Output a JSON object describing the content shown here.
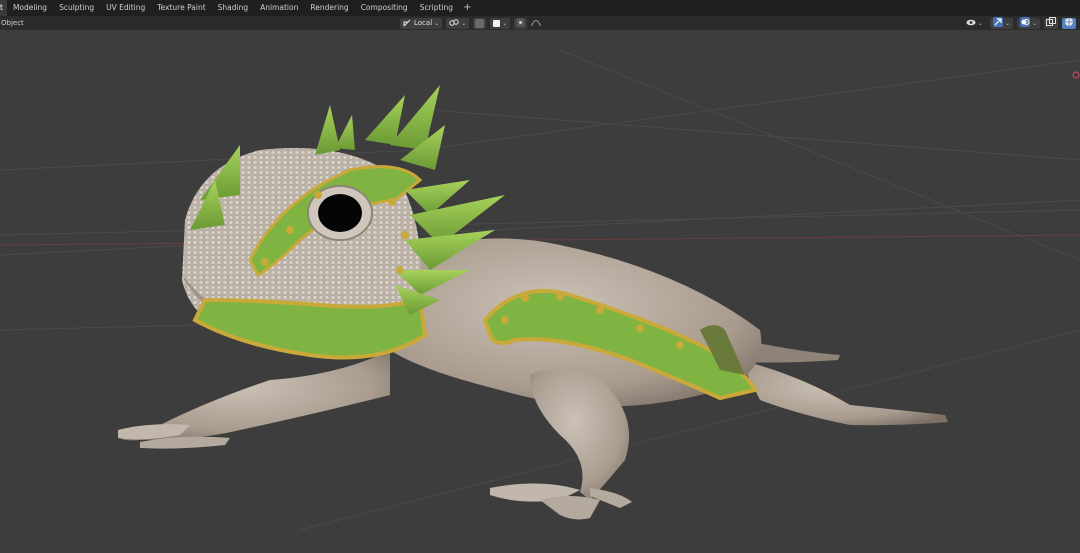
{
  "workspace_tabs": [
    {
      "label": "t",
      "active": true
    },
    {
      "label": "Modeling",
      "active": false
    },
    {
      "label": "Sculpting",
      "active": false
    },
    {
      "label": "UV Editing",
      "active": false
    },
    {
      "label": "Texture Paint",
      "active": false
    },
    {
      "label": "Shading",
      "active": false
    },
    {
      "label": "Animation",
      "active": false
    },
    {
      "label": "Rendering",
      "active": false
    },
    {
      "label": "Compositing",
      "active": false
    },
    {
      "label": "Scripting",
      "active": false
    }
  ],
  "add_workspace_label": "+",
  "header": {
    "mode_label": "Object",
    "transform_pivot": "Local",
    "center_icons": [
      "transform-orientation-icon",
      "snap-link-icon",
      "snap-magnet-icon",
      "snap-square-icon",
      "proportional-dot-icon",
      "falloff-curve-icon"
    ],
    "right_icons": [
      "view-object-types-icon",
      "gizmo-icon",
      "overlays-icon",
      "xray-icon",
      "shading-solid-icon"
    ]
  },
  "viewport": {
    "background_color": "#3d3d3d",
    "subject": "lizard-sculpt",
    "scale_green": "#7fb342",
    "scale_yellow": "#c9a93a",
    "skin_color": "#b9aea2"
  }
}
